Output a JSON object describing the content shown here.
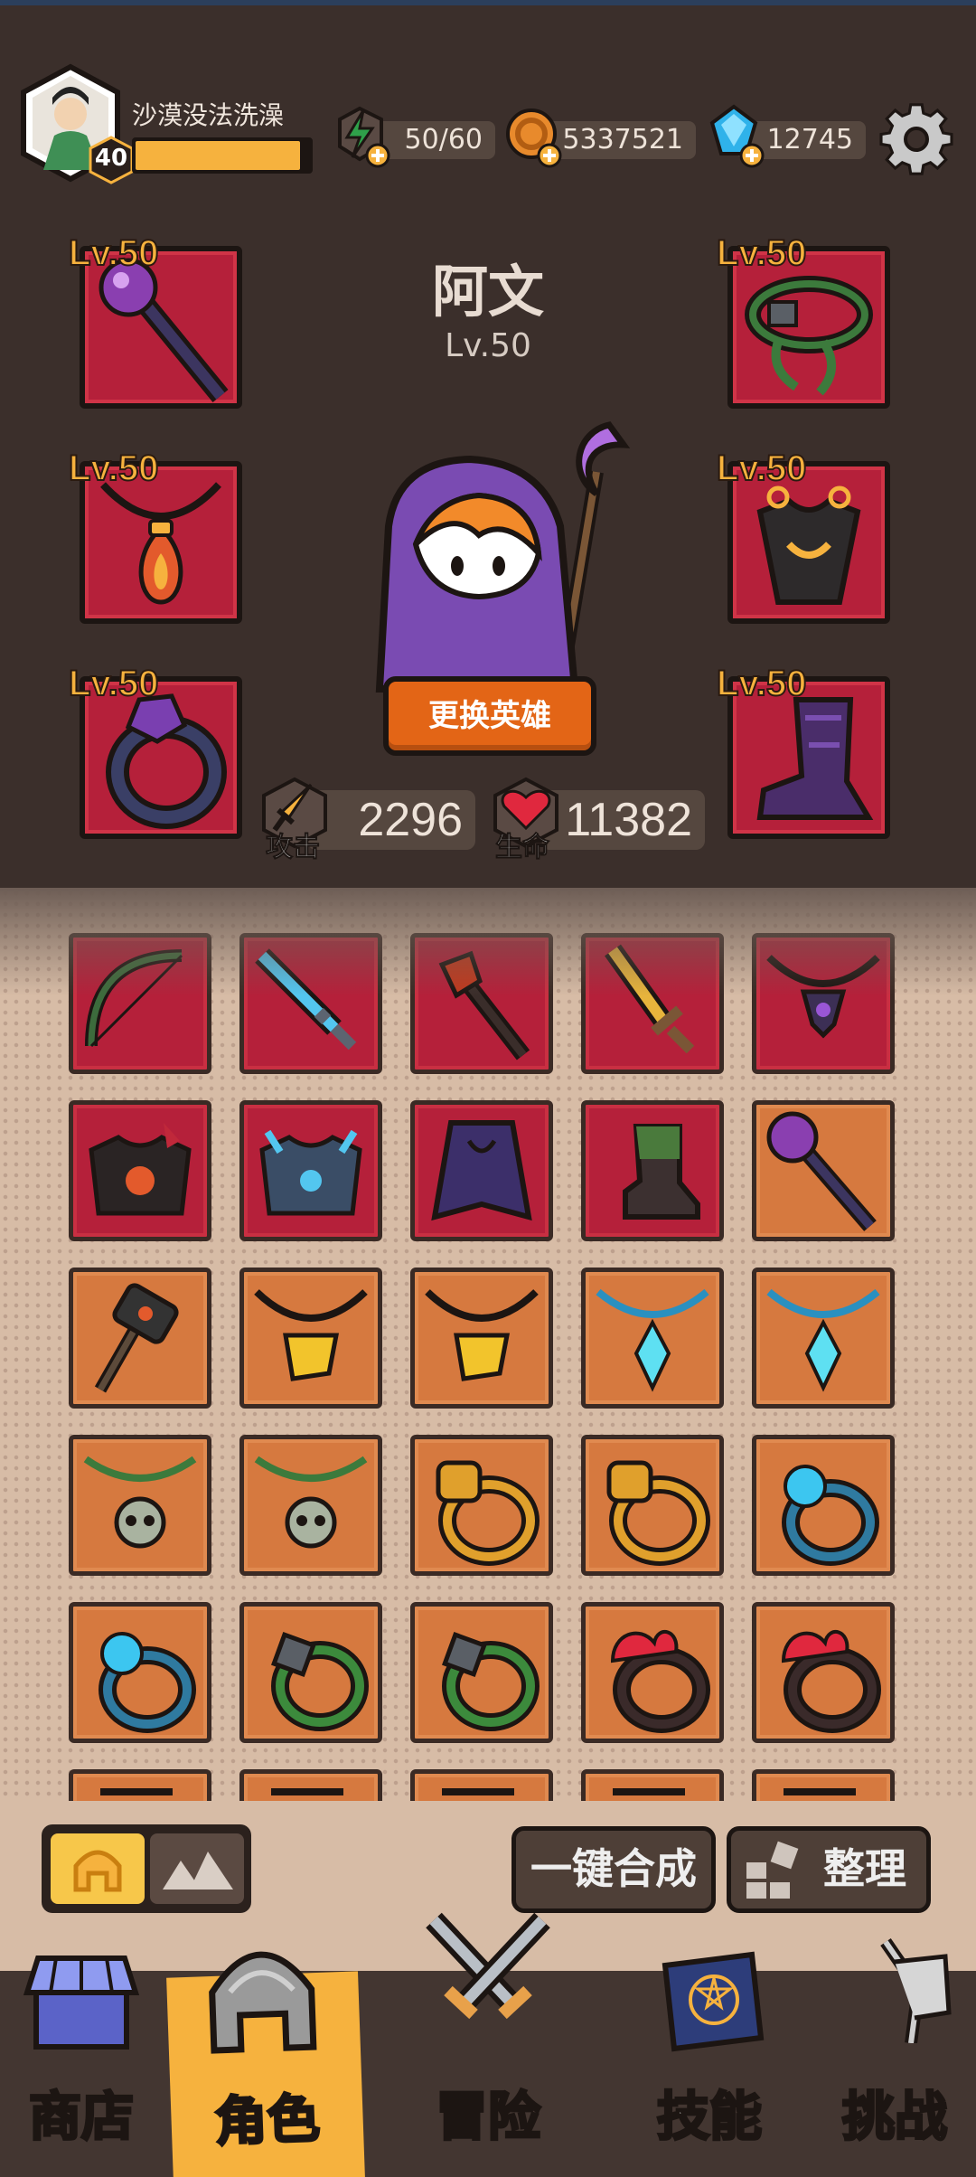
{
  "player": {
    "name": "沙漠没法洗澡",
    "level": "40",
    "xp_fraction": 0.95
  },
  "resources": {
    "energy": "50/60",
    "gold": "5337521",
    "gems": "12745"
  },
  "hero": {
    "name": "阿文",
    "level": "Lv.50",
    "swap_label": "更换英雄"
  },
  "equipped": [
    {
      "slot": "weapon",
      "level": "Lv.50",
      "icon": "purple-staff-icon"
    },
    {
      "slot": "amulet",
      "level": "Lv.50",
      "icon": "fire-amulet-icon"
    },
    {
      "slot": "ring",
      "level": "Lv.50",
      "icon": "purple-ring-icon"
    },
    {
      "slot": "belt",
      "level": "Lv.50",
      "icon": "vine-belt-icon"
    },
    {
      "slot": "armor",
      "level": "Lv.50",
      "icon": "dark-armor-icon"
    },
    {
      "slot": "boots",
      "level": "Lv.50",
      "icon": "shadow-boots-icon"
    }
  ],
  "stats": {
    "attack_label": "攻击",
    "attack_value": "2296",
    "hp_label": "生命",
    "hp_value": "11382"
  },
  "inventory": [
    {
      "icon": "bow-icon",
      "rarity": "red"
    },
    {
      "icon": "ice-sword-icon",
      "rarity": "red"
    },
    {
      "icon": "fire-staff-icon",
      "rarity": "red"
    },
    {
      "icon": "golden-sword-icon",
      "rarity": "red"
    },
    {
      "icon": "dark-amulet-icon",
      "rarity": "red"
    },
    {
      "icon": "lava-armor-icon",
      "rarity": "red"
    },
    {
      "icon": "frost-armor-icon",
      "rarity": "red"
    },
    {
      "icon": "dark-cloak-icon",
      "rarity": "red"
    },
    {
      "icon": "moss-boot-icon",
      "rarity": "red"
    },
    {
      "icon": "purple-staff-icon",
      "rarity": "orange"
    },
    {
      "icon": "war-hammer-icon",
      "rarity": "orange"
    },
    {
      "icon": "gold-amulet-icon",
      "rarity": "orange"
    },
    {
      "icon": "gold-amulet-icon",
      "rarity": "orange"
    },
    {
      "icon": "crystal-amulet-icon",
      "rarity": "orange"
    },
    {
      "icon": "crystal-amulet-icon",
      "rarity": "orange"
    },
    {
      "icon": "skull-necklace-icon",
      "rarity": "orange"
    },
    {
      "icon": "skull-necklace-icon",
      "rarity": "orange"
    },
    {
      "icon": "fist-ring-icon",
      "rarity": "orange"
    },
    {
      "icon": "fist-ring-icon",
      "rarity": "orange"
    },
    {
      "icon": "blue-ring-icon",
      "rarity": "orange"
    },
    {
      "icon": "blue-ring-icon",
      "rarity": "orange"
    },
    {
      "icon": "vine-ring-icon",
      "rarity": "orange"
    },
    {
      "icon": "vine-ring-icon",
      "rarity": "orange"
    },
    {
      "icon": "flame-ring-icon",
      "rarity": "orange"
    },
    {
      "icon": "flame-ring-icon",
      "rarity": "orange"
    },
    {
      "icon": "partial-item-icon",
      "rarity": "orange"
    },
    {
      "icon": "partial-item-icon",
      "rarity": "orange"
    },
    {
      "icon": "partial-item-icon",
      "rarity": "orange"
    },
    {
      "icon": "partial-item-icon",
      "rarity": "orange"
    },
    {
      "icon": "partial-item-icon",
      "rarity": "orange"
    }
  ],
  "toolbar": {
    "merge_label": "一键合成",
    "sort_label": "整理"
  },
  "nav": {
    "shop": "商店",
    "character": "角色",
    "adventure": "冒险",
    "skills": "技能",
    "challenge": "挑战"
  },
  "colors": {
    "panel": "#3b2f2b",
    "slot_red": "#b5203a",
    "slot_orange": "#d6793f",
    "accent": "#f6b23e",
    "button": "#e36516"
  }
}
